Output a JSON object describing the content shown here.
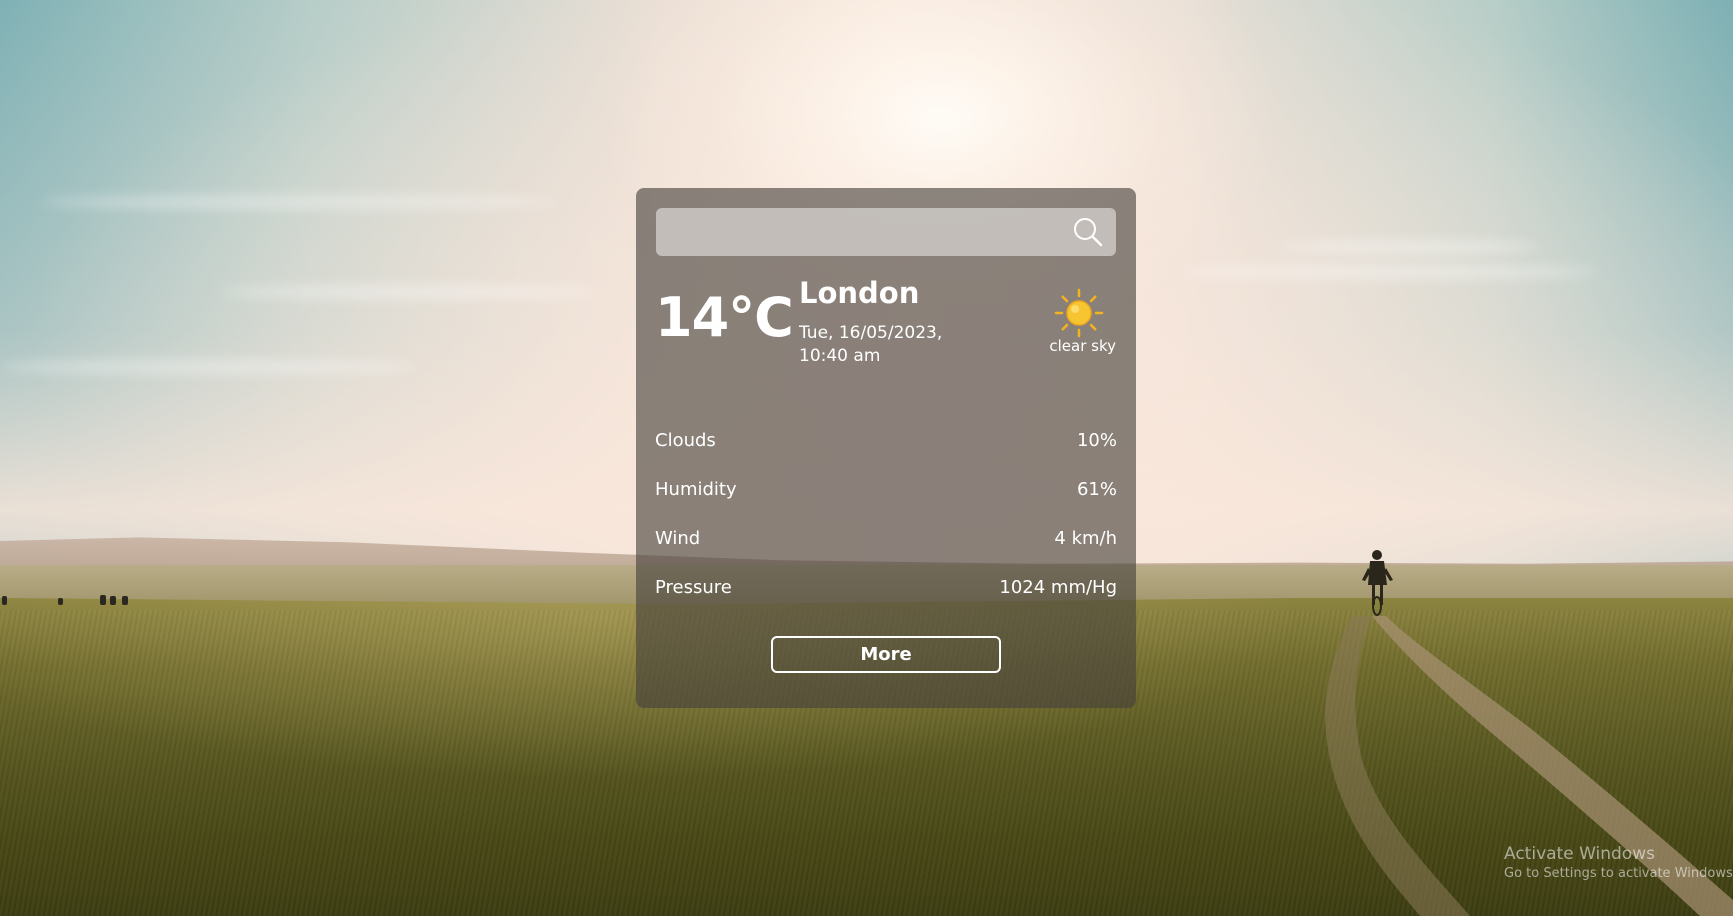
{
  "search": {
    "value": "",
    "placeholder": "",
    "icon": "search-icon"
  },
  "current": {
    "temperature": "14°C",
    "city": "London",
    "datetime": "Tue, 16/05/2023, 10:40 am",
    "condition": "clear sky",
    "condition_icon": "sun-icon"
  },
  "details": [
    {
      "label": "Clouds",
      "value": "10%"
    },
    {
      "label": "Humidity",
      "value": "61%"
    },
    {
      "label": "Wind",
      "value": "4 km/h"
    },
    {
      "label": "Pressure",
      "value": "1024 mm/Hg"
    }
  ],
  "more_button": {
    "label": "More"
  },
  "watermark": {
    "title": "Activate Windows",
    "subtitle": "Go to Settings to activate Windows."
  },
  "colors": {
    "card_bg": "#46403c",
    "text": "#ffffff",
    "sun": "#f7c531"
  }
}
